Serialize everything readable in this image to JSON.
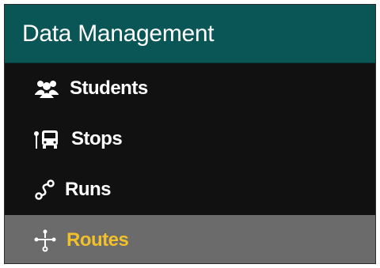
{
  "panel": {
    "title": "Data Management"
  },
  "menu": {
    "items": [
      {
        "label": "Students",
        "icon": "users-icon",
        "active": false
      },
      {
        "label": "Stops",
        "icon": "bus-stop-icon",
        "active": false
      },
      {
        "label": "Runs",
        "icon": "route-path-icon",
        "active": false
      },
      {
        "label": "Routes",
        "icon": "route-network-icon",
        "active": true
      }
    ]
  },
  "colors": {
    "header_bg": "#0a5555",
    "menu_bg": "#111111",
    "active_bg": "#6b6b6b",
    "active_text": "#f2c02a",
    "text": "#ffffff"
  }
}
